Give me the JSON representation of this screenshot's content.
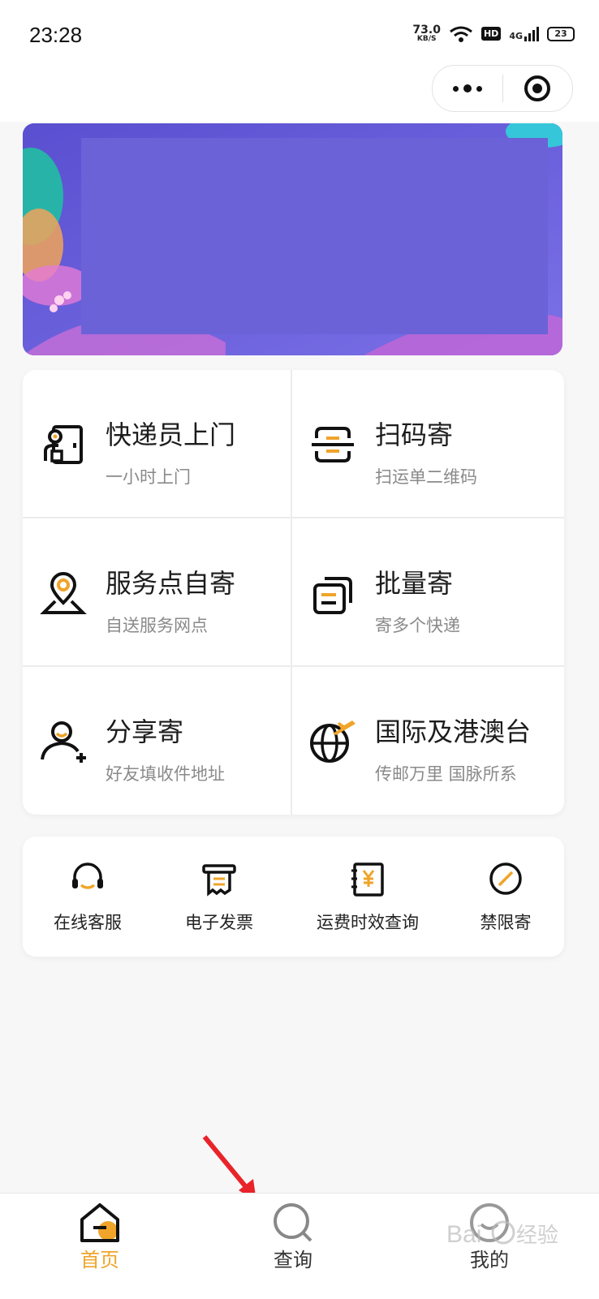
{
  "status_bar": {
    "time": "23:28",
    "net_speed_value": "73.0",
    "net_speed_unit": "KB/S",
    "hd": "HD",
    "signal": "4G",
    "battery": "23"
  },
  "capsule": {
    "more_icon": "more-dots-icon",
    "close_icon": "target-circle-icon"
  },
  "banner": {
    "background_color": "#6b62d8"
  },
  "services": [
    {
      "title": "快递员上门",
      "subtitle": "一小时上门",
      "icon": "courier-door-icon"
    },
    {
      "title": "扫码寄",
      "subtitle": "扫运单二维码",
      "icon": "scan-icon"
    },
    {
      "title": "服务点自寄",
      "subtitle": "自送服务网点",
      "icon": "location-pin-icon"
    },
    {
      "title": "批量寄",
      "subtitle": "寄多个快递",
      "icon": "batch-docs-icon"
    },
    {
      "title": "分享寄",
      "subtitle": "好友填收件地址",
      "icon": "user-add-icon"
    },
    {
      "title": "国际及港澳台",
      "subtitle": "传邮万里 国脉所系",
      "icon": "globe-plane-icon"
    }
  ],
  "tools": [
    {
      "label": "在线客服",
      "icon": "headset-icon"
    },
    {
      "label": "电子发票",
      "icon": "invoice-icon"
    },
    {
      "label": "运费时效查询",
      "icon": "yen-doc-icon"
    },
    {
      "label": "禁限寄",
      "icon": "forbidden-icon"
    }
  ],
  "tabbar": {
    "tabs": [
      {
        "label": "首页",
        "icon": "home-icon",
        "active": true
      },
      {
        "label": "查询",
        "icon": "search-icon",
        "active": false
      },
      {
        "label": "我的",
        "icon": "profile-icon",
        "active": false
      }
    ]
  },
  "accent_color": "#f0a42a",
  "watermark": "Baidu 经验"
}
